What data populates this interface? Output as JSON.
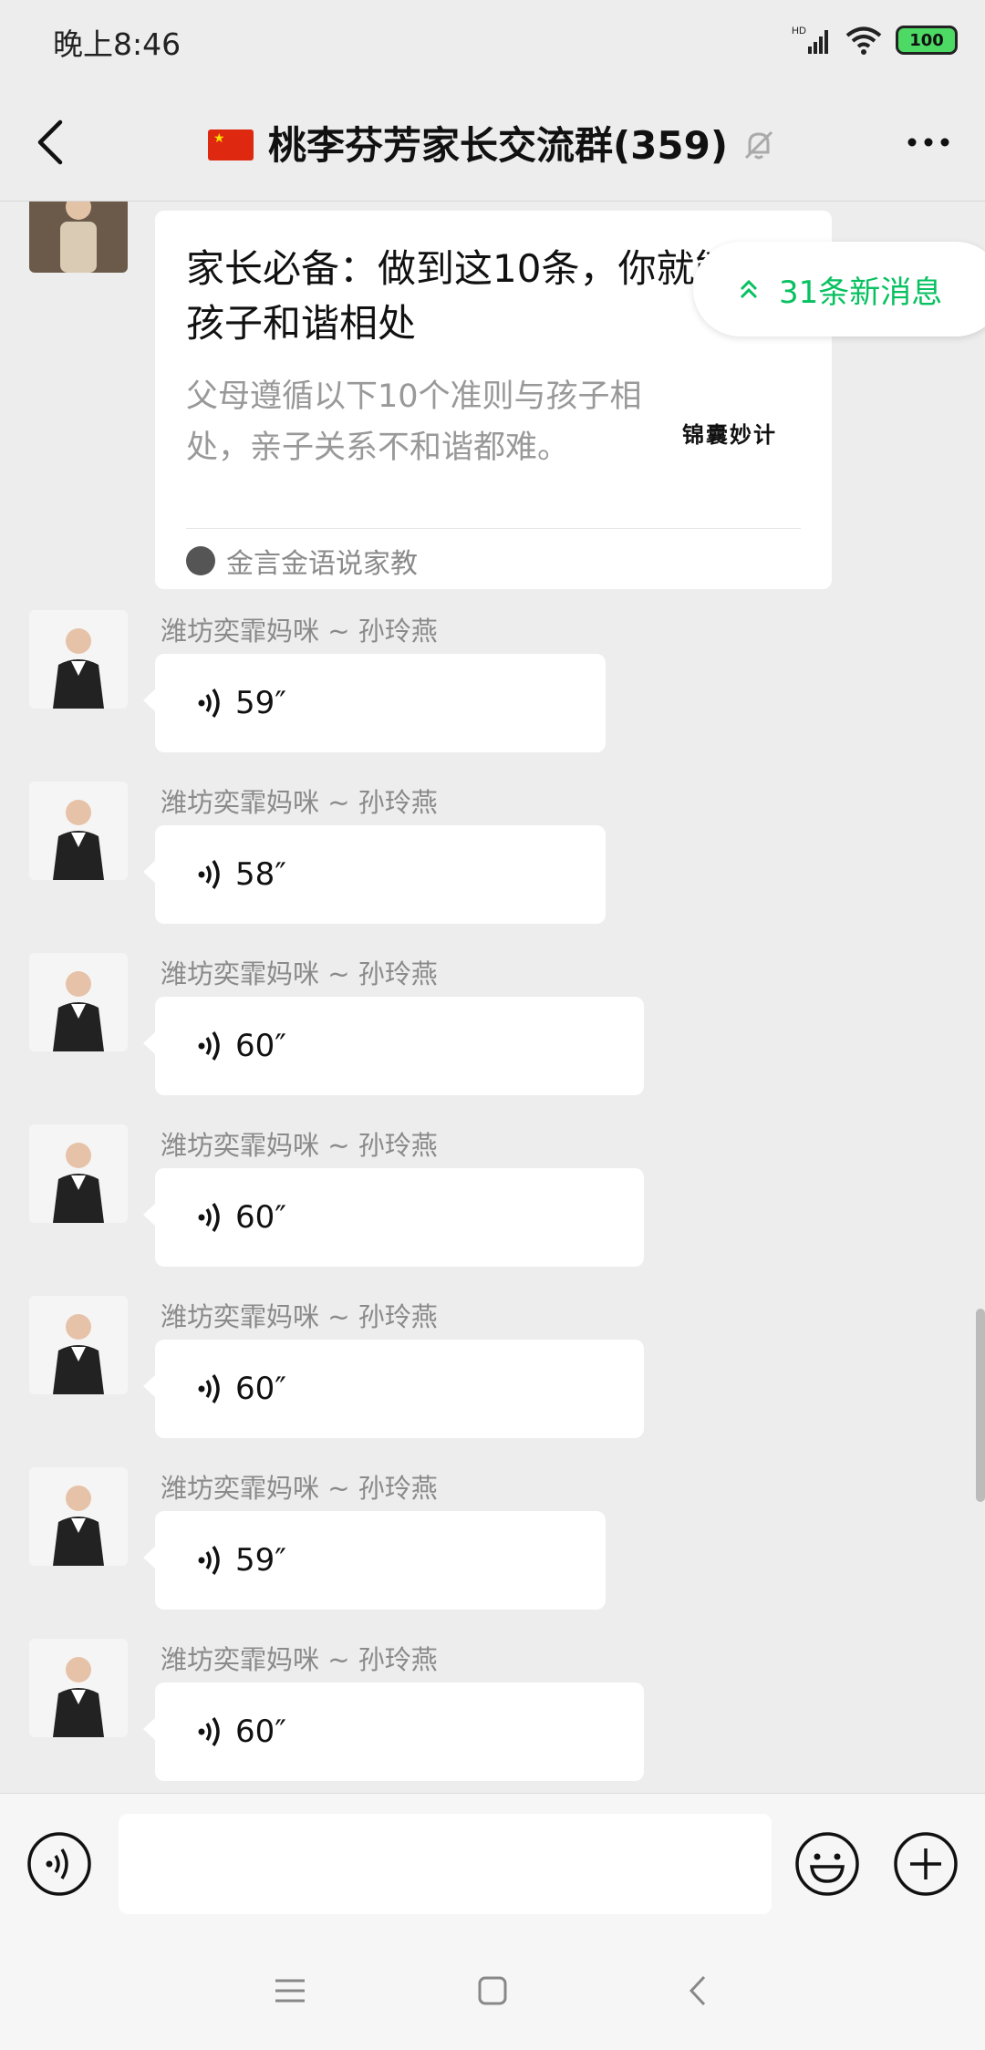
{
  "status": {
    "time": "晚上8:46",
    "battery": "100",
    "network": "HD"
  },
  "header": {
    "flag": "🇨🇳",
    "title": "桃李芬芳家长交流群(359)"
  },
  "card": {
    "title": "家长必备：做到这10条，你就能与孩子和谐相处",
    "description": "父母遵循以下10个准则与孩子相处，亲子关系不和谐都难。",
    "thumb_text": "锦囊妙计",
    "source": "金言金语说家教"
  },
  "new_messages": {
    "label": "31条新消息"
  },
  "messages": [
    {
      "sender": "潍坊奕霏妈咪 ~ 孙玲燕",
      "duration": "59″"
    },
    {
      "sender": "潍坊奕霏妈咪 ~ 孙玲燕",
      "duration": "58″"
    },
    {
      "sender": "潍坊奕霏妈咪 ~ 孙玲燕",
      "duration": "60″"
    },
    {
      "sender": "潍坊奕霏妈咪 ~ 孙玲燕",
      "duration": "60″"
    },
    {
      "sender": "潍坊奕霏妈咪 ~ 孙玲燕",
      "duration": "60″"
    },
    {
      "sender": "潍坊奕霏妈咪 ~ 孙玲燕",
      "duration": "59″"
    },
    {
      "sender": "潍坊奕霏妈咪 ~ 孙玲燕",
      "duration": "60″"
    }
  ],
  "icons": {
    "back": "chevron-left-icon",
    "mute": "bell-off-icon",
    "more": "more-horizontal-icon",
    "voice": "voice-wave-icon",
    "emoji": "smile-icon",
    "plus": "plus-circle-icon"
  },
  "colors": {
    "accent": "#07c160",
    "background": "#ededed",
    "bubble": "#ffffff"
  }
}
